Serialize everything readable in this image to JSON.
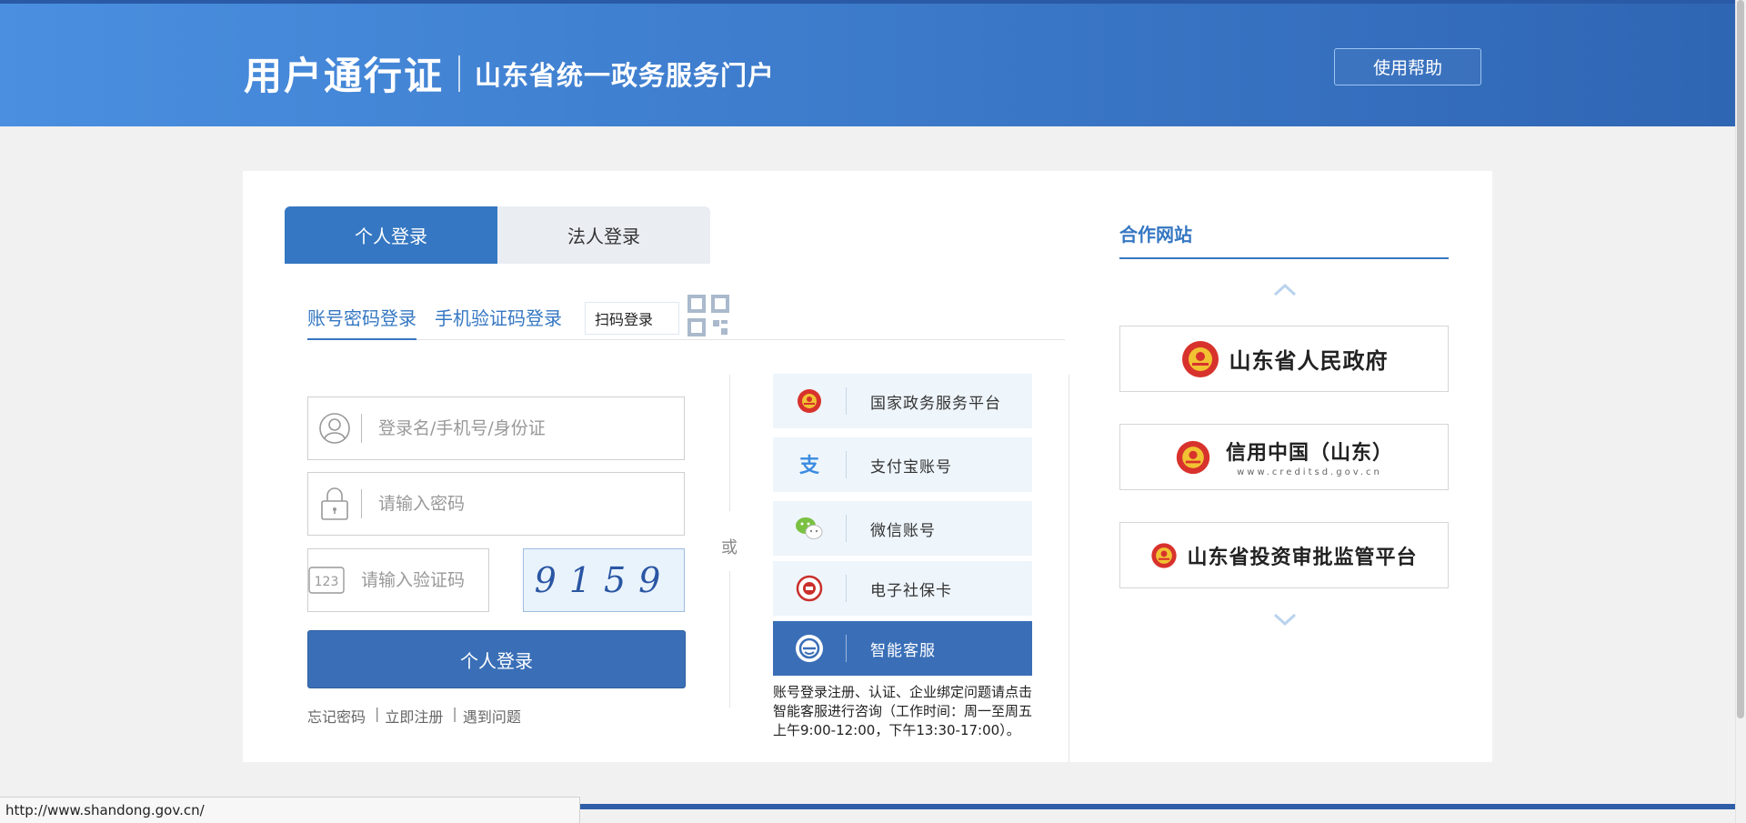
{
  "header": {
    "brand_main": "用户通行证",
    "brand_sub": "山东省统一政务服务门户",
    "help_label": "使用帮助"
  },
  "login": {
    "tabs": [
      {
        "label": "个人登录",
        "active": true
      },
      {
        "label": "法人登录",
        "active": false
      }
    ],
    "subtabs": {
      "account": "账号密码登录",
      "sms": "手机验证码登录",
      "scan": "扫码登录"
    },
    "username_placeholder": "登录名/手机号/身份证",
    "password_placeholder": "请输入密码",
    "code_placeholder": "请输入验证码",
    "captcha_text": "9159",
    "submit_label": "个人登录",
    "links": [
      "忘记密码",
      "立即注册",
      "遇到问题"
    ],
    "link_separator": "|"
  },
  "or_label": "或",
  "alt_logins": [
    {
      "label": "国家政务服务平台",
      "icon": "national-emblem-icon"
    },
    {
      "label": "支付宝账号",
      "icon": "alipay-icon"
    },
    {
      "label": "微信账号",
      "icon": "wechat-icon"
    },
    {
      "label": "电子社保卡",
      "icon": "social-security-icon"
    },
    {
      "label": "智能客服",
      "icon": "customer-service-icon"
    }
  ],
  "service_note": "账号登录注册、认证、企业绑定问题请点击智能客服进行咨询（工作时间：周一至周五上午9:00-12:00，下午13:30-17:00）。",
  "partners": {
    "title": "合作网站",
    "items": [
      {
        "name": "山东省人民政府"
      },
      {
        "name": "信用中国（山东）",
        "sub": "www.creditsd.gov.cn"
      },
      {
        "name": "山东省投资审批监管平台"
      }
    ]
  },
  "status_url": "http://www.shandong.gov.cn/",
  "colors": {
    "primary": "#3577c2",
    "header_gradient_start": "#4a8fe0",
    "header_gradient_end": "#2f66b4",
    "button": "#3a6fb7"
  }
}
